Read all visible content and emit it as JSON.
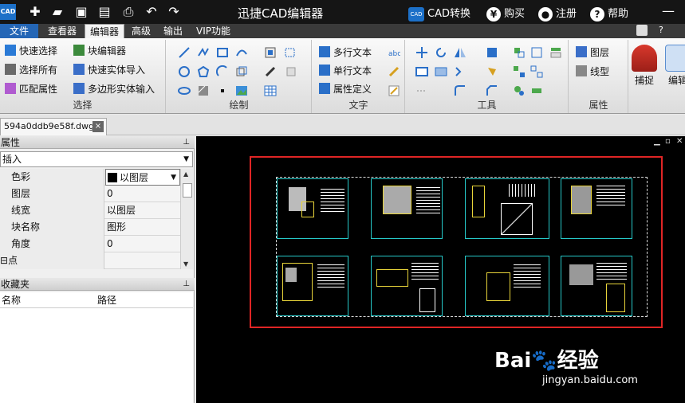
{
  "titlebar": {
    "app_logo": "CAD",
    "title": "迅捷CAD编辑器",
    "cad_convert": "CAD转换",
    "buy_icon": "¥",
    "buy": "购买",
    "register": "注册",
    "help_icon": "?",
    "help": "帮助",
    "quick_icons": [
      "new-icon",
      "open-icon",
      "save-icon",
      "save-as-icon",
      "print-icon",
      "undo-icon",
      "redo-icon"
    ]
  },
  "menubar": {
    "items": [
      "文件",
      "查看器",
      "编辑器",
      "高级",
      "输出",
      "VIP功能"
    ],
    "active": "编辑器"
  },
  "ribbon": {
    "select_group": {
      "label": "选择",
      "quick_select": "快速选择",
      "select_all": "选择所有",
      "match_props": "匹配属性",
      "block_editor": "块编辑器",
      "quick_solid_import": "快速实体导入",
      "polygon_solid_input": "多边形实体输入"
    },
    "draw_group": {
      "label": "绘制"
    },
    "text_group": {
      "label": "文字",
      "mtext": "多行文本",
      "stext": "单行文本",
      "attdef": "属性定义"
    },
    "tools_group": {
      "label": "工具"
    },
    "props_group": {
      "label": "属性",
      "layer": "图层",
      "linetype": "线型"
    },
    "snap": "捕捉",
    "edit": "编辑"
  },
  "document_tab": {
    "filename": "594a0ddb9e58f.dwg",
    "close": "×"
  },
  "properties_panel": {
    "title": "属性",
    "pin": "⊥",
    "selector": "插入",
    "rows": [
      {
        "name": "色彩",
        "value": "以图层"
      },
      {
        "name": "图层",
        "value": "0"
      },
      {
        "name": "线宽",
        "value": "以图层"
      },
      {
        "name": "块名称",
        "value": "图形"
      },
      {
        "name": "角度",
        "value": "0"
      }
    ],
    "section": "点",
    "section_toggle": "⊟"
  },
  "favorites_panel": {
    "title": "收藏夹",
    "pin": "⊥",
    "columns": [
      "名称",
      "路径"
    ]
  },
  "canvas": {
    "window_controls": [
      "▁",
      "▫",
      "✕"
    ],
    "sheet_count": 8,
    "colors": {
      "background": "#000000",
      "highlight": "#e02525",
      "sheet_border": "#26c8c8"
    }
  },
  "watermark": {
    "brand": "Bai",
    "paw": "🐾",
    "suffix": "经验",
    "url": "jingyan.baidu.com"
  }
}
